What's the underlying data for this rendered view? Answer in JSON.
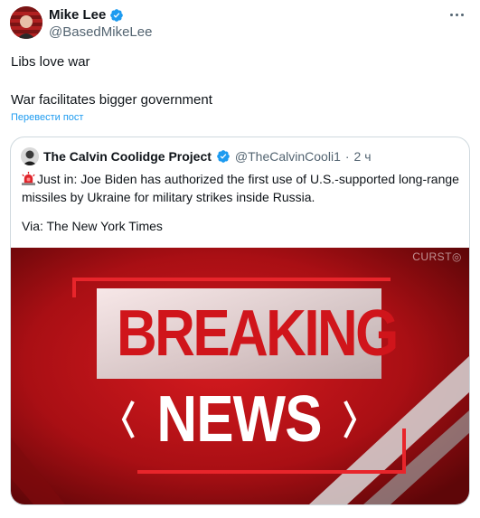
{
  "author": {
    "name": "Mike Lee",
    "handle": "@BasedMikeLee"
  },
  "post": {
    "lines": [
      "Libs love war",
      "War facilitates bigger government"
    ],
    "translate_label": "Перевести пост"
  },
  "quote": {
    "author_name": "The Calvin Coolidge Project",
    "author_handle": "@TheCalvinCooli1",
    "dot": "·",
    "time": "2 ч",
    "text": "Just in: Joe Biden has authorized the first use of U.S.-supported long-range missiles by Ukraine for military strikes inside Russia.",
    "via": "Via: The New York Times",
    "media": {
      "headline_1": "BREAKING",
      "headline_2": "NEWS",
      "watermark": "CURST◎"
    }
  },
  "colors": {
    "accent": "#1d9bf0",
    "verified": "#1d9bf0",
    "muted_text": "#536471",
    "breaking_red": "#c8151b"
  },
  "icons": {
    "verified": "verified-badge-icon",
    "more": "more-options-icon",
    "siren": "siren-icon"
  }
}
